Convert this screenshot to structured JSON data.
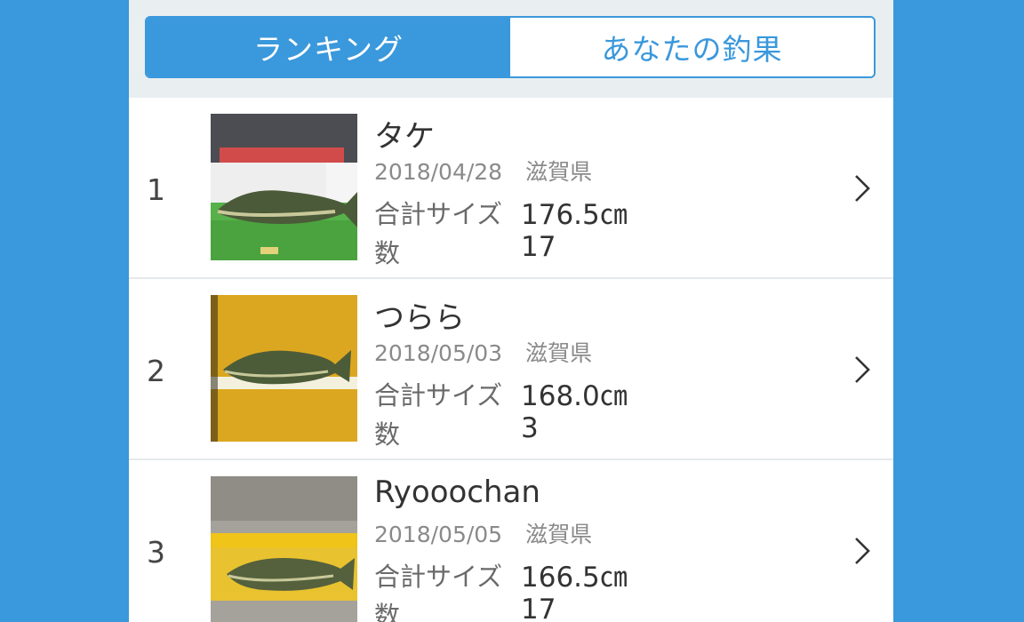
{
  "tabs": {
    "ranking": "ランキング",
    "my_catch": "あなたの釣果"
  },
  "labels": {
    "total_size": "合計サイズ",
    "count": "数"
  },
  "rows": [
    {
      "rank": "1",
      "name": "タケ",
      "date": "2018/04/28",
      "prefecture": "滋賀県",
      "total_size": "176.5㎝",
      "count": "17"
    },
    {
      "rank": "2",
      "name": "つらら",
      "date": "2018/05/03",
      "prefecture": "滋賀県",
      "total_size": "168.0㎝",
      "count": "3"
    },
    {
      "rank": "3",
      "name": "Ryooochan",
      "date": "2018/05/05",
      "prefecture": "滋賀県",
      "total_size": "166.5㎝",
      "count": "17"
    }
  ],
  "colors": {
    "accent": "#3a98dc",
    "header_bg": "#e9eef1"
  }
}
